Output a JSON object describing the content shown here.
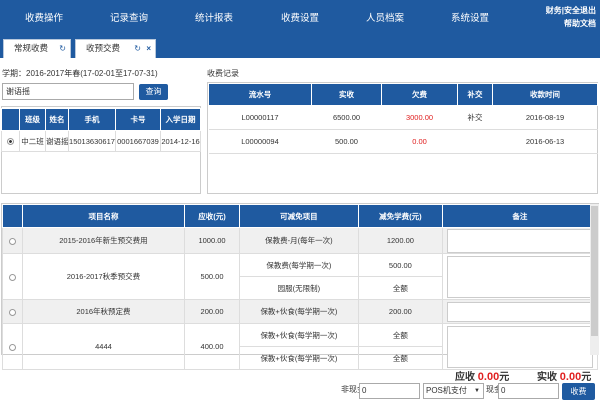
{
  "nav": {
    "items": [
      "收费操作",
      "记录查询",
      "统计报表",
      "收费设置",
      "人员档案",
      "系统设置"
    ],
    "links": [
      "财务|安全退出",
      "帮助文档"
    ]
  },
  "tabs": [
    {
      "label": "常规收费"
    },
    {
      "label": "收预交费"
    }
  ],
  "term": "学期：2016-2017年春(17-02-01至17-07-31)",
  "search": {
    "value": "谢语摇",
    "button": "查询"
  },
  "students": {
    "headers": [
      "",
      "班级",
      "姓名",
      "手机",
      "卡号",
      "入学日期"
    ],
    "rows": [
      [
        "",
        "中二班",
        "谢语摇",
        "15013630617",
        "0001667039",
        "2014-12-16"
      ]
    ]
  },
  "records": {
    "title": "收费记录",
    "headers": [
      "流水号",
      "实收",
      "欠费",
      "补交",
      "收款时间"
    ],
    "rows": [
      [
        "L00000117",
        "6500.00",
        "3000.00",
        "补交",
        "2016-08-19"
      ],
      [
        "L00000094",
        "500.00",
        "0.00",
        "",
        "2016-06-13"
      ]
    ]
  },
  "items": {
    "headers": [
      "",
      "项目名称",
      "应收(元)",
      "可减免项目",
      "减免学费(元)",
      "备注"
    ],
    "rows": [
      {
        "name": "2015-2016年新生预交费用",
        "amount": "1000.00",
        "subs": [
          [
            "保教费-月(每年一次)",
            "1200.00"
          ]
        ]
      },
      {
        "name": "2016-2017秋季预交费",
        "amount": "500.00",
        "subs": [
          [
            "保教费(每学期一次)",
            "500.00"
          ],
          [
            "园服(无限制)",
            "全额"
          ]
        ]
      },
      {
        "name": "2016年秋预定费",
        "amount": "200.00",
        "subs": [
          [
            "保教+伙食(每学期一次)",
            "200.00"
          ]
        ]
      },
      {
        "name": "4444",
        "amount": "400.00",
        "subs": [
          [
            "保教+伙食(每学期一次)",
            "全额"
          ],
          [
            "保教+伙食(每学期一次)",
            "全额"
          ]
        ]
      }
    ]
  },
  "totals": {
    "due_label": "应收",
    "due": "0.00",
    "due_unit": "元",
    "paid_label": "实收",
    "paid": "0.00",
    "paid_unit": "元"
  },
  "payment": {
    "noncash_label": "非现金",
    "noncash_value": "0",
    "method": "POS机支付",
    "cash_label": "现金",
    "cash_value": "0",
    "submit": "收费"
  }
}
